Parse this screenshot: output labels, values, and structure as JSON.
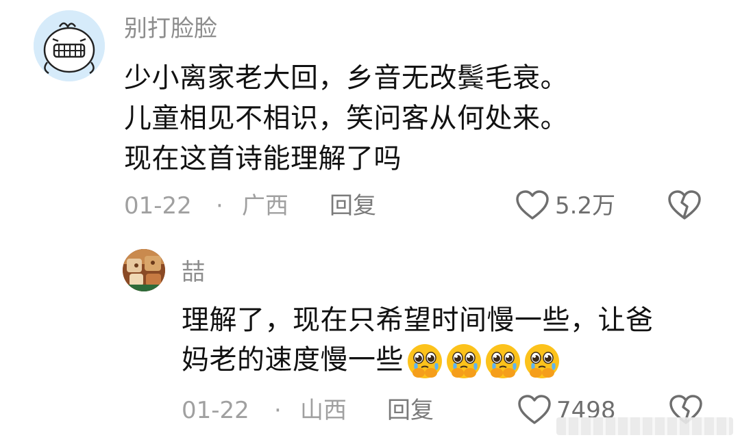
{
  "comments": [
    {
      "username": "别打脸脸",
      "lines": [
        "少小离家老大回，乡音无改鬓毛衰。",
        "儿童相见不相识，笑问客从何处来。",
        "现在这首诗能理解了吗"
      ],
      "date": "01-22",
      "location": "广西",
      "reply_label": "回复",
      "likes": "5.2万"
    },
    {
      "username": "喆",
      "lines": [
        "理解了，现在只希望时间慢一些，让爸",
        "妈老的速度慢一些"
      ],
      "date": "01-22",
      "location": "山西",
      "reply_label": "回复",
      "likes": "7498"
    }
  ],
  "separator": "·",
  "icons": {
    "like": "heart-outline-icon",
    "dislike": "broken-heart-icon",
    "emoji": "pleading-face-emoji"
  },
  "colors": {
    "text": "#111111",
    "meta": "#a0a0a0",
    "username": "#8d8d8d",
    "icon": "#6e6e6e",
    "emoji_face": "#fcc21b"
  }
}
